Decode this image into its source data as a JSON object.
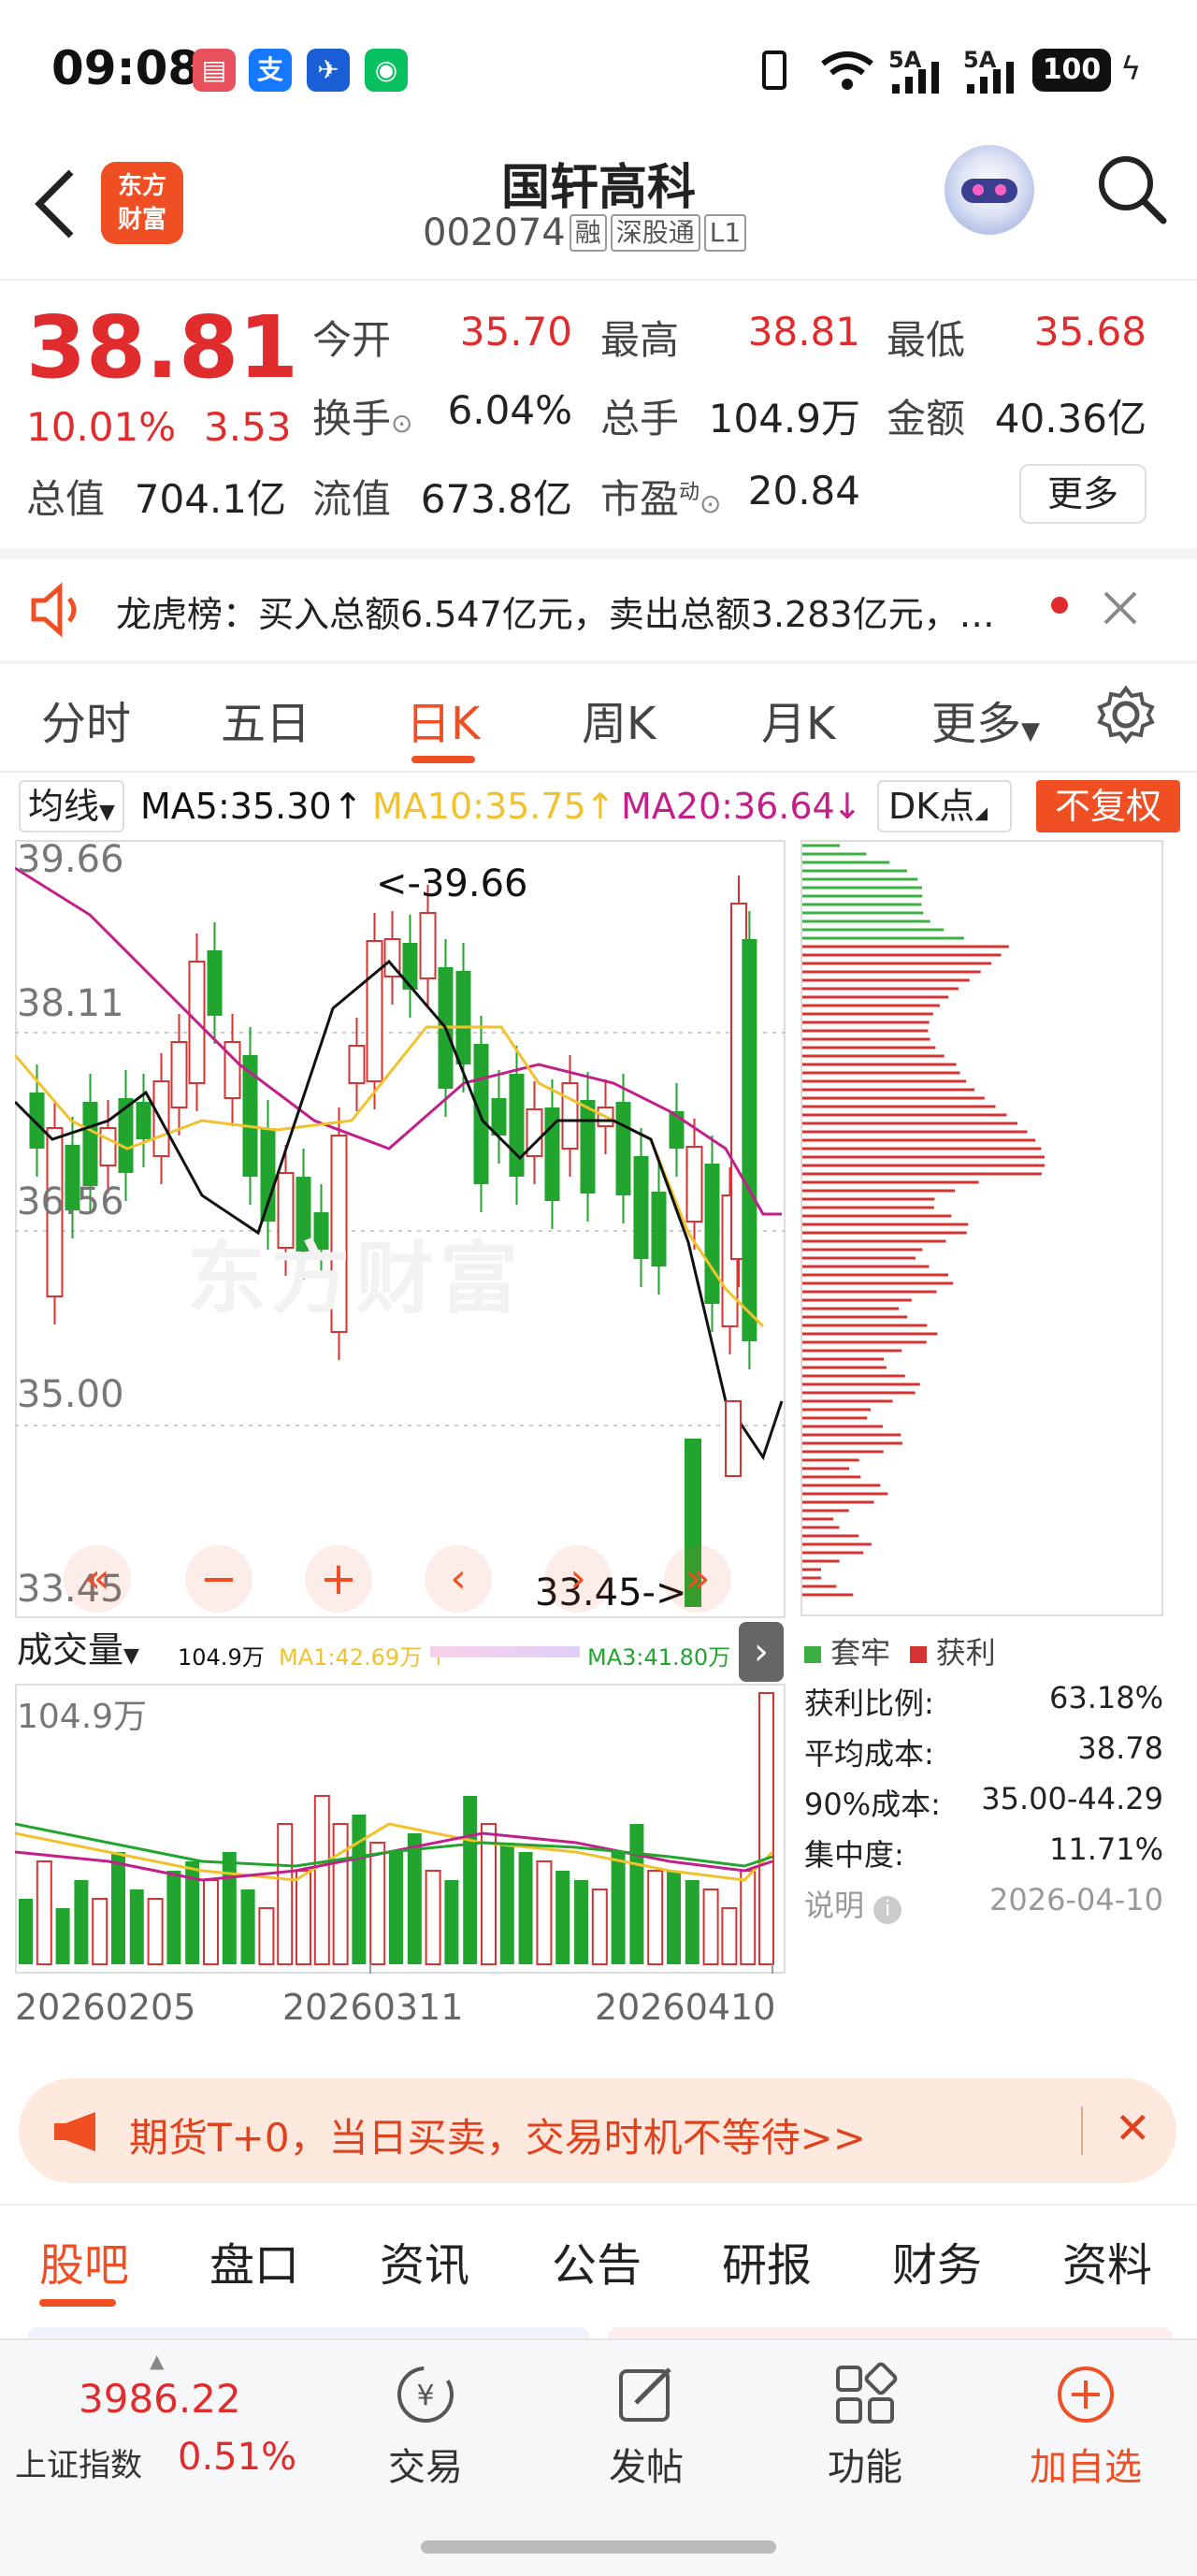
{
  "status_bar": {
    "time": "09:08",
    "app_icons": [
      "book-icon",
      "alipay-icon",
      "airline-icon",
      "wechat-icon"
    ],
    "network_1": "5A",
    "network_2": "5A",
    "battery": "100"
  },
  "header": {
    "logo_line1": "东方",
    "logo_line2": "财富",
    "stock_name": "国轩高科",
    "stock_code": "002074",
    "tags": [
      "融",
      "深股通",
      "L1"
    ]
  },
  "quote": {
    "price": "38.81",
    "change_pct": "10.01%",
    "change_amt": "3.53",
    "open_label": "今开",
    "open_val": "35.70",
    "high_label": "最高",
    "high_val": "38.81",
    "low_label": "最低",
    "low_val": "35.68",
    "turnover_label": "换手",
    "turnover_val": "6.04%",
    "volume_label": "总手",
    "volume_val": "104.9万",
    "amount_label": "金额",
    "amount_val": "40.36亿",
    "mktcap_label": "总值",
    "mktcap_val": "704.1亿",
    "float_label": "流值",
    "float_val": "673.8亿",
    "pe_label": "市盈",
    "pe_sup": "动",
    "pe_val": "20.84",
    "more_btn": "更多"
  },
  "notice": {
    "text": "龙虎榜：买入总额6.547亿元，卖出总额3.283亿元，…"
  },
  "chart_tabs": {
    "items": [
      "分时",
      "五日",
      "日K",
      "周K",
      "月K",
      "更多"
    ],
    "active": "日K"
  },
  "indicator_bar": {
    "ma_select": "均线",
    "ma5": "MA5:35.30",
    "ma10": "MA10:35.75",
    "ma20": "MA20:36.64",
    "dk": "DK点",
    "fq": "不复权",
    "ma5_color": "#111111",
    "ma10_color": "#f2c12e",
    "ma20_color": "#c21f8a"
  },
  "kline": {
    "y_labels": [
      "39.66",
      "38.11",
      "36.56",
      "35.00",
      "33.45"
    ],
    "high_mark": "<-39.66",
    "low_mark": "33.45->",
    "watermark": "东方财富",
    "up_color": "#d63333",
    "down_color": "#22a52e"
  },
  "volume": {
    "select": "成交量",
    "v_val": "104.9万",
    "ma1": "MA1:42.69万",
    "ma3": "MA3:41.80万",
    "y_top": "104.9万",
    "dates": [
      "20260205",
      "20260311",
      "20260410"
    ]
  },
  "chip": {
    "legend_trapped": "套牢",
    "legend_profit": "获利",
    "rows": [
      {
        "label": "获利比例:",
        "value": "63.18%"
      },
      {
        "label": "平均成本:",
        "value": "38.78"
      },
      {
        "label": "90%成本:",
        "value": "35.00-44.29"
      },
      {
        "label": "集中度:",
        "value": "11.71%"
      }
    ],
    "note_label": "说明",
    "note_date": "2026-04-10"
  },
  "ad": {
    "text": "期货T+0，当日买卖，交易时机不等待>>"
  },
  "section_tabs": {
    "items": [
      "股吧",
      "盘口",
      "资讯",
      "公告",
      "研报",
      "财务",
      "资料"
    ],
    "active": "股吧"
  },
  "bottom_bar": {
    "index_value": "3986.22",
    "index_name": "上证指数",
    "index_pct": "0.51%",
    "nav": [
      "交易",
      "发帖",
      "功能",
      "加自选"
    ]
  }
}
